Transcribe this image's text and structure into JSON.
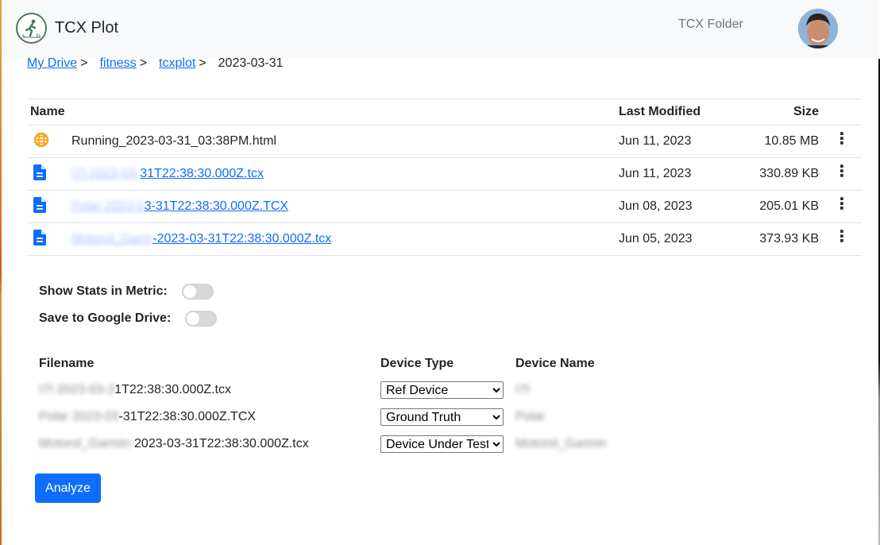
{
  "app": {
    "title": "TCX Plot",
    "nav_link": "TCX Folder"
  },
  "breadcrumb": {
    "items": [
      {
        "label": "My Drive"
      },
      {
        "label": "fitness"
      },
      {
        "label": "tcxplot"
      }
    ],
    "current": "2023-03-31",
    "separator": ">"
  },
  "files": {
    "columns": {
      "name": "Name",
      "modified": "Last Modified",
      "size": "Size"
    },
    "rows": [
      {
        "icon": "globe-icon",
        "blurred": "",
        "name": "Running_2023-03-31_03:38PM.html",
        "modified": "Jun 11, 2023",
        "size": "10.85 MB",
        "link": false
      },
      {
        "icon": "document-icon",
        "blurred": "I7I 2023-03-",
        "name": "31T22:38:30.000Z.tcx",
        "modified": "Jun 11, 2023",
        "size": "330.89 KB",
        "link": true
      },
      {
        "icon": "document-icon",
        "blurred": "Polar 2023-0",
        "name": "3-31T22:38:30.000Z.TCX",
        "modified": "Jun 08, 2023",
        "size": "205.01 KB",
        "link": true
      },
      {
        "icon": "document-icon",
        "blurred": "Motorol_Garm",
        "name": "-2023-03-31T22:38:30.000Z.tcx",
        "modified": "Jun 05, 2023",
        "size": "373.93 KB",
        "link": true
      }
    ],
    "menu_glyph": "⋮"
  },
  "options": {
    "metric_label": "Show Stats in Metric:",
    "metric_on": false,
    "drive_label": "Save to Google Drive:",
    "drive_on": false
  },
  "devices": {
    "columns": {
      "filename": "Filename",
      "type": "Device Type",
      "name": "Device Name"
    },
    "rows": [
      {
        "blurred": "I7I 2023-03-3",
        "filename": "1T22:38:30.000Z.tcx",
        "type": "Ref Device",
        "device_name": "I7I"
      },
      {
        "blurred": "Polar 2023-03",
        "filename": "-31T22:38:30.000Z.TCX",
        "type": "Ground Truth",
        "device_name": "Polar"
      },
      {
        "blurred": "Motorol_Garmin-",
        "filename": "2023-03-31T22:38:30.000Z.tcx",
        "type": "Device Under Test",
        "device_name": "Motorol_Garmin"
      }
    ]
  },
  "actions": {
    "analyze_label": "Analyze"
  },
  "colors": {
    "primary": "#0d6efd",
    "globe": "#f5a623",
    "logo": "#4a7a5e"
  }
}
